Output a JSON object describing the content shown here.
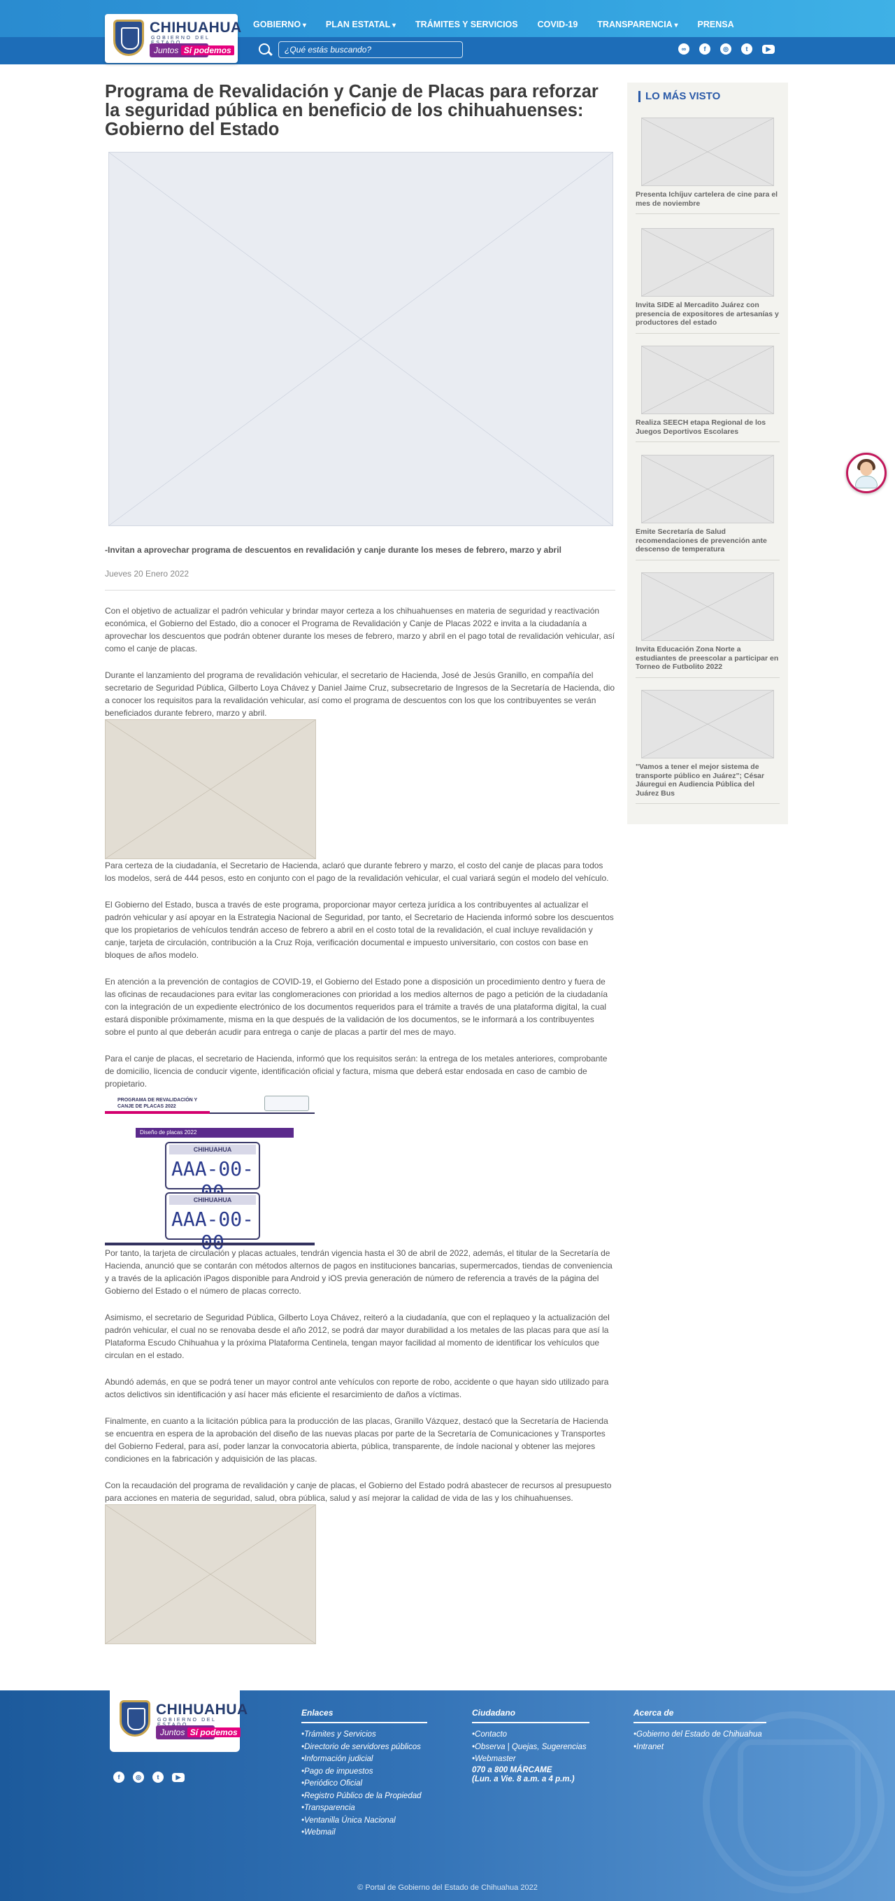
{
  "header": {
    "logo_title": "CHIHUAHUA",
    "logo_subtitle": "GOBIERNO DEL ESTADO",
    "logo_tagline_a": "Juntos",
    "logo_tagline_b": "Sí podemos",
    "nav": [
      "GOBIERNO",
      "PLAN ESTATAL",
      "TRÁMITES Y SERVICIOS",
      "COVID-19",
      "TRANSPARENCIA",
      "PRENSA"
    ],
    "search_placeholder": "¿Qué estás buscando?",
    "social_icons": [
      "link-icon",
      "facebook-icon",
      "instagram-icon",
      "twitter-icon",
      "youtube-icon"
    ]
  },
  "article": {
    "title": "Programa de Revalidación y Canje de Placas para reforzar la seguridad pública en beneficio de los chihuahuenses: Gobierno del Estado",
    "lead": "-Invitan a aprovechar programa de descuentos en revalidación y canje durante los meses de febrero, marzo y abril",
    "date": "Jueves 20 Enero 2022",
    "paragraphs": [
      "Con el objetivo de actualizar el padrón vehicular y brindar mayor certeza a los chihuahuenses en materia de seguridad y reactivación económica, el Gobierno del Estado, dio a conocer el Programa de Revalidación y Canje de Placas 2022 e invita a la ciudadanía a aprovechar los descuentos que podrán obtener durante los meses de febrero, marzo y abril en el pago total de revalidación vehicular, así como el canje de placas.",
      "Durante el lanzamiento del programa de revalidación vehicular, el secretario de Hacienda, José de Jesús Granillo, en compañía del secretario de Seguridad Pública, Gilberto Loya Chávez y Daniel Jaime Cruz, subsecretario de Ingresos de la Secretaría de Hacienda, dio a conocer los requisitos para la revalidación vehicular, así como el programa de descuentos con los que los contribuyentes se verán beneficiados durante febrero, marzo y abril.",
      "Para certeza de la ciudadanía, el Secretario de Hacienda, aclaró que durante febrero y marzo, el costo del canje de placas para todos los modelos, será de 444 pesos, esto en conjunto con el pago de la revalidación vehicular, el cual variará según el modelo del vehículo.",
      "El Gobierno del Estado, busca a través de este programa, proporcionar mayor certeza jurídica a los contribuyentes al actualizar el padrón vehicular y así apoyar en la Estrategia Nacional de Seguridad, por tanto, el Secretario de Hacienda informó sobre los descuentos que los propietarios de vehículos tendrán acceso de febrero a abril en el costo total de la revalidación, el cual incluye revalidación y canje, tarjeta de circulación, contribución a la Cruz Roja, verificación documental e impuesto universitario, con costos con base en bloques de años modelo.",
      "En atención a la prevención de contagios de COVID-19, el Gobierno del Estado pone a disposición un procedimiento dentro y fuera de las oficinas de recaudaciones para evitar las conglomeraciones con prioridad a los medios alternos de pago a petición de la ciudadanía con la integración de un expediente electrónico de los documentos requeridos para el trámite a través de una plataforma digital, la cual estará disponible próximamente, misma en la que después de la validación de los documentos, se le informará a los contribuyentes sobre el punto al que deberán acudir para entrega o canje de placas a partir del mes de mayo.",
      "Para el canje de placas, el secretario de Hacienda, informó que los requisitos serán: la entrega de los metales anteriores, comprobante de domicilio, licencia de conducir vigente, identificación oficial y factura, misma que deberá estar endosada en caso de cambio de propietario.",
      "Por tanto, la tarjeta de circulación y placas actuales, tendrán vigencia hasta el 30 de abril de 2022, además, el titular de la Secretaría de Hacienda, anunció que se contarán con métodos alternos de pagos en instituciones bancarias, supermercados, tiendas de conveniencia y a través de la aplicación iPagos disponible para Android y iOS previa generación de número de referencia a través de la página del Gobierno del Estado o el número de placas correcto.",
      "Asimismo, el secretario de Seguridad Pública, Gilberto Loya Chávez, reiteró a la ciudadanía, que con el replaqueo y la actualización del padrón vehicular, el cual no se renovaba desde el año 2012, se podrá dar mayor durabilidad a los metales de las placas para que así la Plataforma Escudo Chihuahua y la próxima Plataforma Centinela, tengan mayor facilidad al momento de identificar los vehículos que circulan en el estado.",
      "Abundó además, en que se podrá tener un mayor control ante vehículos con reporte de robo, accidente o que hayan sido utilizado para actos delictivos sin identificación y así hacer más eficiente el resarcimiento de daños a víctimas.",
      "Finalmente, en cuanto a la licitación pública para la producción de las placas, Granillo Vázquez, destacó que la Secretaría de Hacienda se encuentra en espera de la aprobación del diseño de las nuevas placas por parte de la Secretaría de Comunicaciones y Transportes del Gobierno Federal, para así, poder lanzar la convocatoria abierta, pública, transparente, de índole nacional y obtener las mejores condiciones en la fabricación y adquisición de las placas.",
      "Con la recaudación del programa de revalidación y canje de placas, el Gobierno del Estado podrá abastecer de recursos al presupuesto para acciones en materia de seguridad, salud, obra pública, salud y así mejorar la calidad de vida de las y los chihuahuenses."
    ],
    "plates_graphic": {
      "heading": "PROGRAMA DE REVALIDACIÓN Y\nCANJE DE PLACAS 2022",
      "label": "Diseño de placas 2022",
      "plate_state": "CHIHUAHUA",
      "plate_number": "AAA-00-00"
    }
  },
  "sidebar": {
    "heading": "LO MÁS VISTO",
    "items": [
      "Presenta Ichíjuv cartelera de cine para el mes de noviembre",
      "Invita SIDE al Mercadito Juárez con presencia de expositores de artesanías y productores del estado",
      "Realiza SEECH etapa Regional de los Juegos Deportivos Escolares",
      "Emite Secretaría de Salud recomendaciones de prevención ante descenso de temperatura",
      "Invita Educación Zona Norte a estudiantes de preescolar a participar en Torneo de Futbolito 2022",
      "\"Vamos a tener el mejor sistema de transporte público en Juárez\"; César Jáuregui en Audiencia Pública del Juárez Bus"
    ]
  },
  "footer": {
    "enlaces": {
      "title": "Enlaces",
      "links": [
        "•Trámites y Servicios",
        "•Directorio de servidores públicos",
        "•Información judicial",
        "•Pago de impuestos",
        "•Periódico Oficial",
        "•Registro Público de la Propiedad",
        "•Transparencia",
        "•Ventanilla Única Nacional",
        "•Webmail"
      ]
    },
    "ciudadano": {
      "title": "Ciudadano",
      "links": [
        "•Contacto",
        "•Observa | Quejas, Sugerencias",
        "•Webmaster"
      ],
      "phone": "070 a 800 MÁRCAME",
      "hours": "(Lun. a Vie. 8 a.m. a 4 p.m.)"
    },
    "acerca": {
      "title": "Acerca de",
      "links": [
        "•Gobierno del Estado de Chihuahua",
        "•Intranet"
      ]
    },
    "copyright": "© Portal de Gobierno del Estado de Chihuahua 2022"
  },
  "colors": {
    "header_blue": "#2f9ddd",
    "nav_bar": "#1d6db8",
    "infographic_navy": "#3c3b6e",
    "accent_magenta": "#d3006f",
    "accent_purple": "#5b2a8c"
  }
}
